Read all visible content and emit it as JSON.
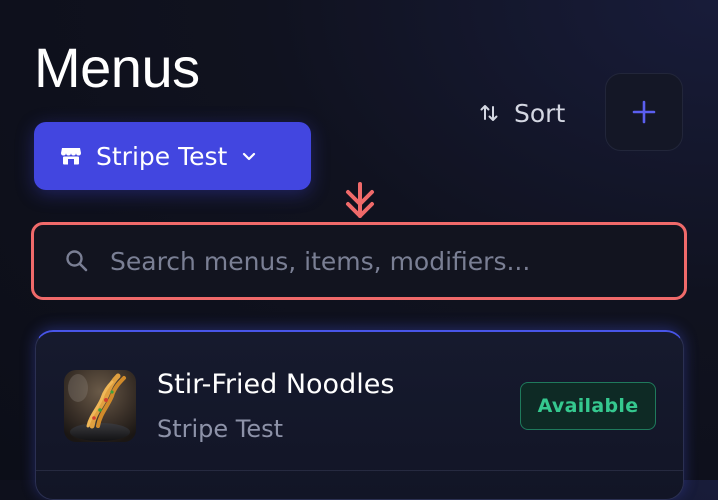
{
  "header": {
    "title": "Menus",
    "sort_label": "Sort"
  },
  "store_selector": {
    "selected": "Stripe Test"
  },
  "search": {
    "placeholder": "Search menus, items, modifiers...",
    "value": ""
  },
  "menu_items": [
    {
      "name": "Stir-Fried Noodles",
      "store": "Stripe Test",
      "status": "Available"
    }
  ],
  "icons": {
    "store": "storefront-icon",
    "chevron": "chevron-down-icon",
    "sort": "sort-icon",
    "add": "plus-icon",
    "search": "search-icon",
    "annotation": "arrow-down-annotation"
  },
  "colors": {
    "primary": "#4246e0",
    "accent_plus": "#5b5ff0",
    "available_text": "#35c88f",
    "available_bg": "#0e2a25",
    "highlight": "#f06a6a"
  }
}
